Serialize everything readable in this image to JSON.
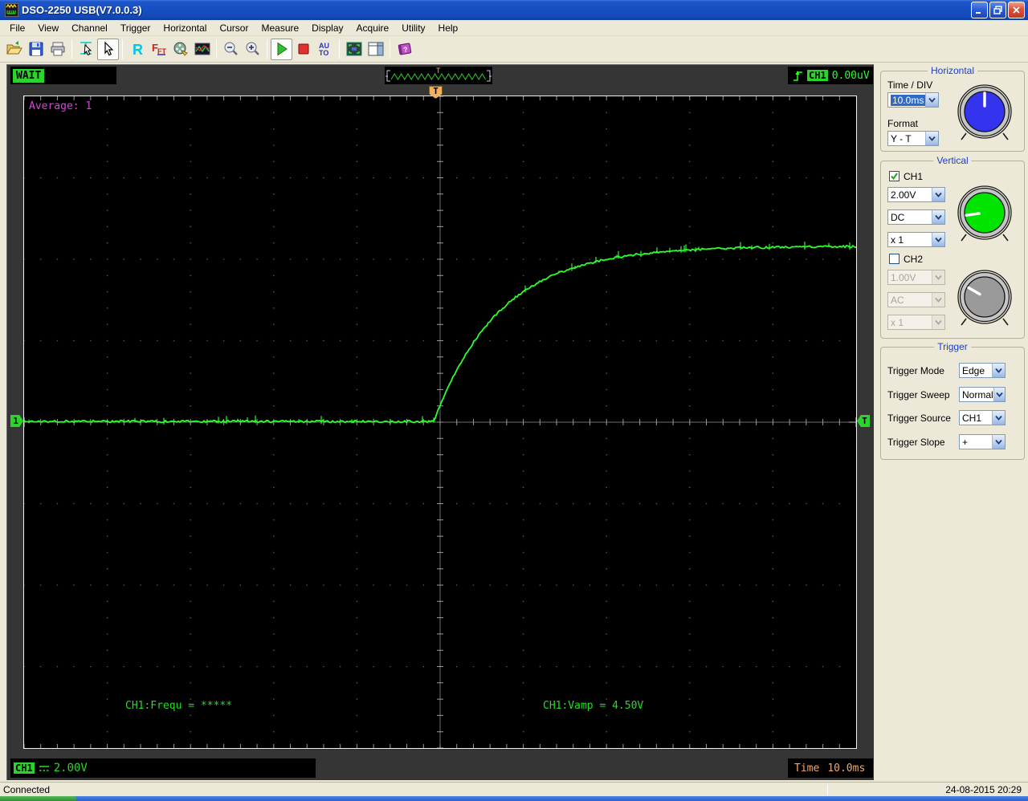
{
  "window": {
    "title": "DSO-2250 USB(V7.0.0.3)",
    "buttons": {
      "minimize": "_",
      "restore": "❏",
      "close": "×"
    }
  },
  "menubar": {
    "items": [
      "File",
      "View",
      "Channel",
      "Trigger",
      "Horizontal",
      "Cursor",
      "Measure",
      "Display",
      "Acquire",
      "Utility",
      "Help"
    ]
  },
  "toolbar": {
    "buttons": [
      "open",
      "save",
      "print",
      "|",
      "cursor-measure",
      "pointer",
      "|",
      "refresh-r",
      "fft",
      "animation",
      "waveform-display",
      "|",
      "zoom-out",
      "zoom-in",
      "|",
      "run",
      "stop",
      "auto-set",
      "|",
      "full-screen",
      "window-layout",
      "|",
      "help-book"
    ],
    "pressed": [
      "pointer",
      "run"
    ],
    "auto_set_label_top": "AU",
    "auto_set_label_bottom": "TO",
    "refresh_r_label": "R",
    "fft_label": "FFT"
  },
  "status_strip": {
    "acquisition_status": "WAIT",
    "preview_marker": "T",
    "trigger_slope_icon": "rising-edge",
    "trigger_source_badge": "CH1",
    "trigger_level": "0.00uV"
  },
  "scope": {
    "average_text": "Average: 1",
    "freq_readout": "CH1:Frequ = *****",
    "vamp_readout": "CH1:Vamp = 4.50V",
    "top_marker": "T",
    "ch1_position_marker": "1",
    "trigger_level_marker": "T",
    "grid": {
      "cols": 10,
      "rows": 8,
      "minor_per_div": 5
    }
  },
  "chart_data": {
    "type": "line",
    "title": "CH1 step response (exponential rise)",
    "series": [
      {
        "name": "CH1",
        "color": "#2bff2b"
      }
    ],
    "volts_per_div": 2.0,
    "time_per_div_ms": 10.0,
    "x_range_divs": 10,
    "y_range_divs": 8,
    "baseline_divs_from_center": 0,
    "settled_level_divs_above_center": 2.15,
    "step_amplitude_v": 4.5,
    "step_time_at_div": 0,
    "time_constant_divs": 0.8,
    "description": "Trace flat at vertical center until trigger point at horizontal center, then rises exponentially and settles about 2.15 divisions above center (Vamp 4.50V at 2.00V/div)."
  },
  "bottom_bar": {
    "ch1_badge": "CH1",
    "coupling_icon": "dc-coupling",
    "ch1_scale": "2.00V",
    "time_label": "Time",
    "time_value": "10.0ms"
  },
  "right_panel": {
    "horizontal": {
      "title": "Horizontal",
      "time_div_label": "Time / DIV",
      "time_div_value": "10.0ms",
      "format_label": "Format",
      "format_value": "Y - T"
    },
    "vertical": {
      "title": "Vertical",
      "ch1": {
        "label": "CH1",
        "checked": true,
        "volt": "2.00V",
        "coupling": "DC",
        "probe": "x 1"
      },
      "ch2": {
        "label": "CH2",
        "checked": false,
        "volt": "1.00V",
        "coupling": "AC",
        "probe": "x 1"
      }
    },
    "trigger": {
      "title": "Trigger",
      "rows": [
        {
          "label": "Trigger Mode",
          "value": "Edge"
        },
        {
          "label": "Trigger Sweep",
          "value": "Normal"
        },
        {
          "label": "Trigger Source",
          "value": "CH1"
        },
        {
          "label": "Trigger Slope",
          "value": "+"
        }
      ]
    }
  },
  "statusbar": {
    "connection": "Connected",
    "datetime": "24-08-2015  20:29"
  },
  "colors": {
    "trace_green": "#2bff2b",
    "badge_green": "#2ad42a",
    "average_magenta": "#d544d5",
    "time_orange": "#f0a868",
    "panel_dark": "#353535",
    "display_black": "#000000",
    "xp_beige": "#ece9d8",
    "group_title_blue": "#1a3fd0",
    "knob_blue": "#3434ee",
    "knob_green": "#00e400",
    "knob_gray": "#9a9a9a",
    "grid_dot": "#5a5a5a",
    "center_line": "#6e6e6e"
  }
}
